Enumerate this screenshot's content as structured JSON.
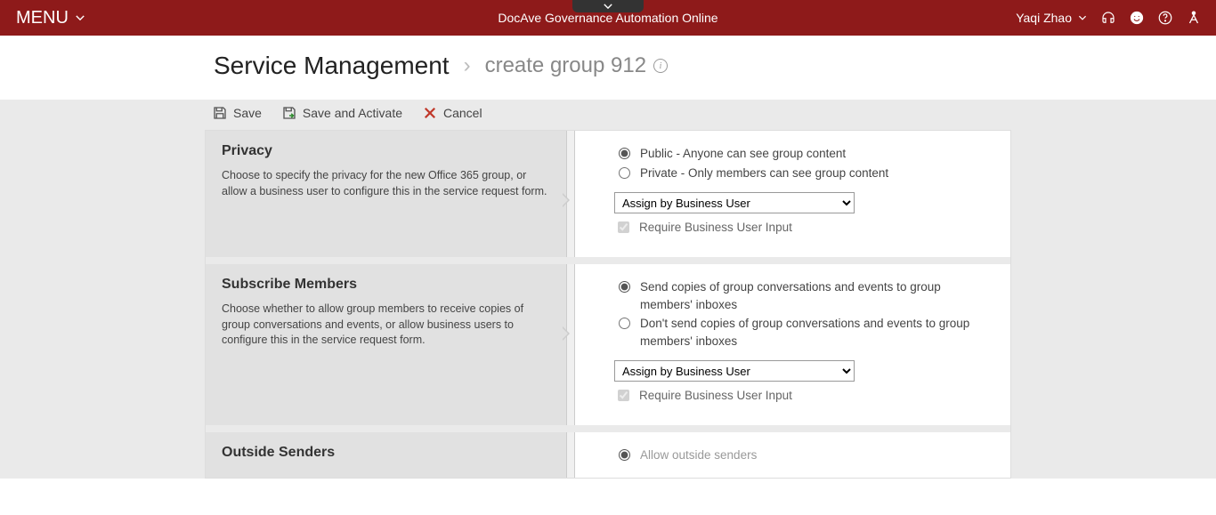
{
  "header": {
    "menu_label": "MENU",
    "app_title": "DocAve Governance Automation Online",
    "user_name": "Yaqi Zhao"
  },
  "breadcrumb": {
    "parent": "Service Management",
    "current": "create group 912"
  },
  "toolbar": {
    "save": "Save",
    "save_activate": "Save and Activate",
    "cancel": "Cancel"
  },
  "sections": {
    "privacy": {
      "title": "Privacy",
      "desc": "Choose to specify the privacy for the new Office 365 group, or allow a business user to configure this in the service request form.",
      "opt_public": "Public - Anyone can see group content",
      "opt_private": "Private - Only members can see group content",
      "assign_select": "Assign by Business User",
      "require_input": "Require Business User Input"
    },
    "subscribe": {
      "title": "Subscribe Members",
      "desc": "Choose whether to allow group members to receive copies of group conversations and events, or allow business users to configure this in the service request form.",
      "opt_send": "Send copies of group conversations and events to group members' inboxes",
      "opt_dont": "Don't send copies of group conversations and events to group members' inboxes",
      "assign_select": "Assign by Business User",
      "require_input": "Require Business User Input"
    },
    "outside": {
      "title": "Outside Senders",
      "opt_allow": "Allow outside senders"
    }
  }
}
